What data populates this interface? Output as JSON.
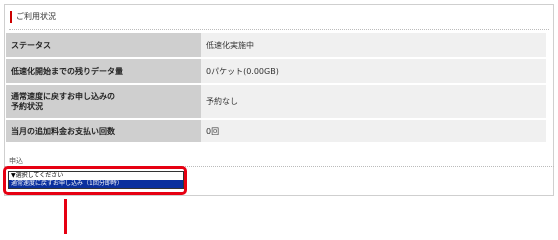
{
  "section": {
    "title": "ご利用状況"
  },
  "status_table": {
    "rows": [
      {
        "label": "ステータス",
        "value": "低速化実施中"
      },
      {
        "label": "低速化開始までの残りデータ量",
        "value": "0パケット(0.00GB)"
      },
      {
        "label_lines": [
          "通常速度に戻すお申し込みの",
          "予約状況"
        ],
        "value": "予約なし"
      },
      {
        "label": "当月の追加料金お支払い回数",
        "value": "0回"
      }
    ]
  },
  "apply": {
    "label": "申込",
    "options": [
      "▼選択してください",
      "通常速度に戻すお申し込み（1回分即時）"
    ],
    "selected_index": 1
  },
  "colors": {
    "accent": "#e60012",
    "label_bg": "#cfcfcf",
    "value_bg": "#f0f0f0",
    "selection_bg": "#0a2f9e"
  }
}
